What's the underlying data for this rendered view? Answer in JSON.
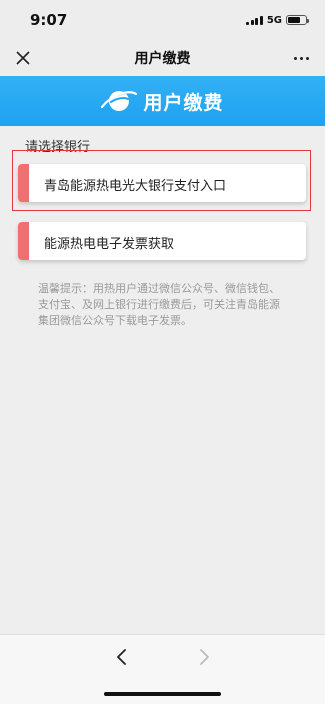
{
  "status_bar": {
    "time": "9:07",
    "network": "5G",
    "battery_level": 0.7
  },
  "nav": {
    "title": "用户缴费",
    "close_icon": "close-icon",
    "more_icon": "more-icon"
  },
  "banner": {
    "logo_icon": "planet-ring-logo",
    "title": "用户缴费",
    "background_color": "#23a6f2"
  },
  "main": {
    "section_label": "请选择银行",
    "options": [
      {
        "label": "青岛能源热电光大银行支付入口",
        "accent_color": "#f07070",
        "highlighted": true
      },
      {
        "label": "能源热电电子发票获取",
        "accent_color": "#f07070",
        "highlighted": false
      }
    ],
    "tip": "温馨提示：用热用户通过微信公众号、微信钱包、支付宝、及网上银行进行缴费后，可关注青岛能源集团微信公众号下载电子发票。"
  },
  "bottom_nav": {
    "back_icon": "chevron-left-icon",
    "forward_icon": "chevron-right-icon"
  }
}
